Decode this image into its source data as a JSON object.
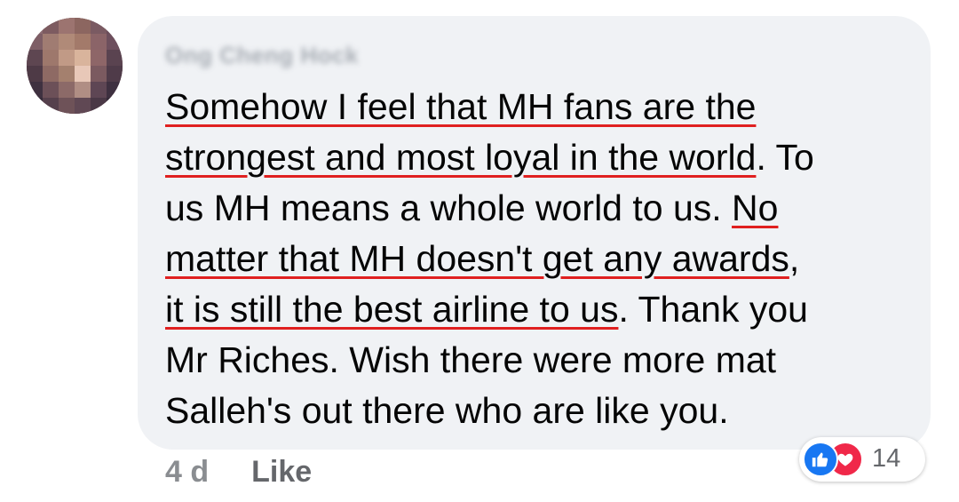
{
  "comment": {
    "author_name": "Ong Cheng Hock",
    "lines": [
      {
        "u": "Somehow I feel that MH fans are the",
        "t": ""
      },
      {
        "u": "strongest and most loyal in the world",
        "t": ". To"
      },
      {
        "p": "us MH means a whole world to us. ",
        "u": "No",
        "t": ""
      },
      {
        "u": "matter that MH doesn't get any awards",
        "t": ","
      },
      {
        "u": "it is still the best airline to us",
        "t": ". Thank you"
      },
      {
        "p": "Mr Riches. Wish there were more mat"
      },
      {
        "p": "Salleh's out there who are like you."
      }
    ]
  },
  "meta": {
    "time": "4 d",
    "like_label": "Like"
  },
  "reactions": {
    "icons": [
      "like-icon",
      "love-icon"
    ],
    "count": "14"
  },
  "colors": {
    "bubble": "#f0f2f5",
    "underline": "#e02020",
    "like_blue": "#1877f2",
    "love_red": "#f02849"
  }
}
